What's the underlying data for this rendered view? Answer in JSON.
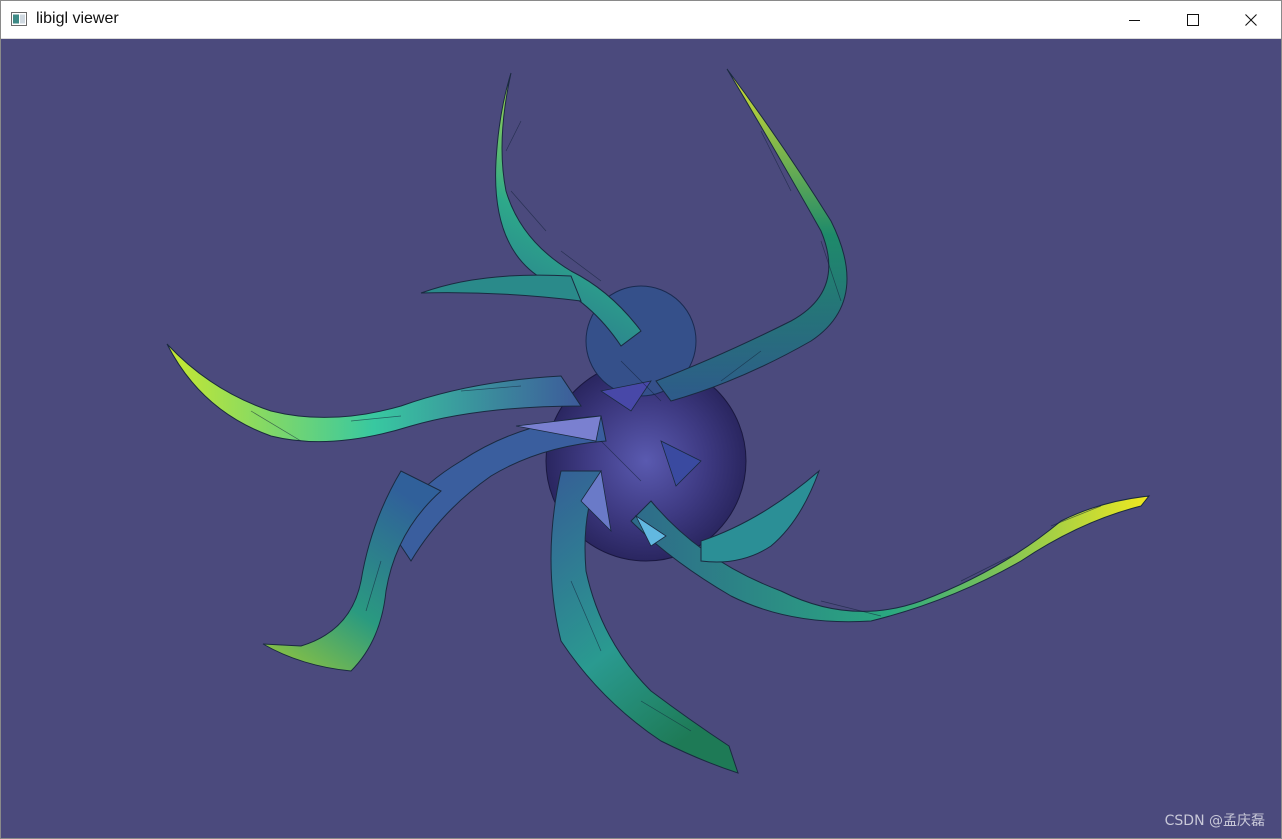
{
  "window": {
    "title": "libigl viewer",
    "icon": "app-window-icon",
    "controls": {
      "minimize_icon": "minimize-icon",
      "maximize_icon": "maximize-icon",
      "close_icon": "close-icon"
    }
  },
  "viewport": {
    "background_color": "#4b4a7d",
    "model": "octopus mesh"
  },
  "watermark": {
    "text": "CSDN @孟庆磊"
  }
}
